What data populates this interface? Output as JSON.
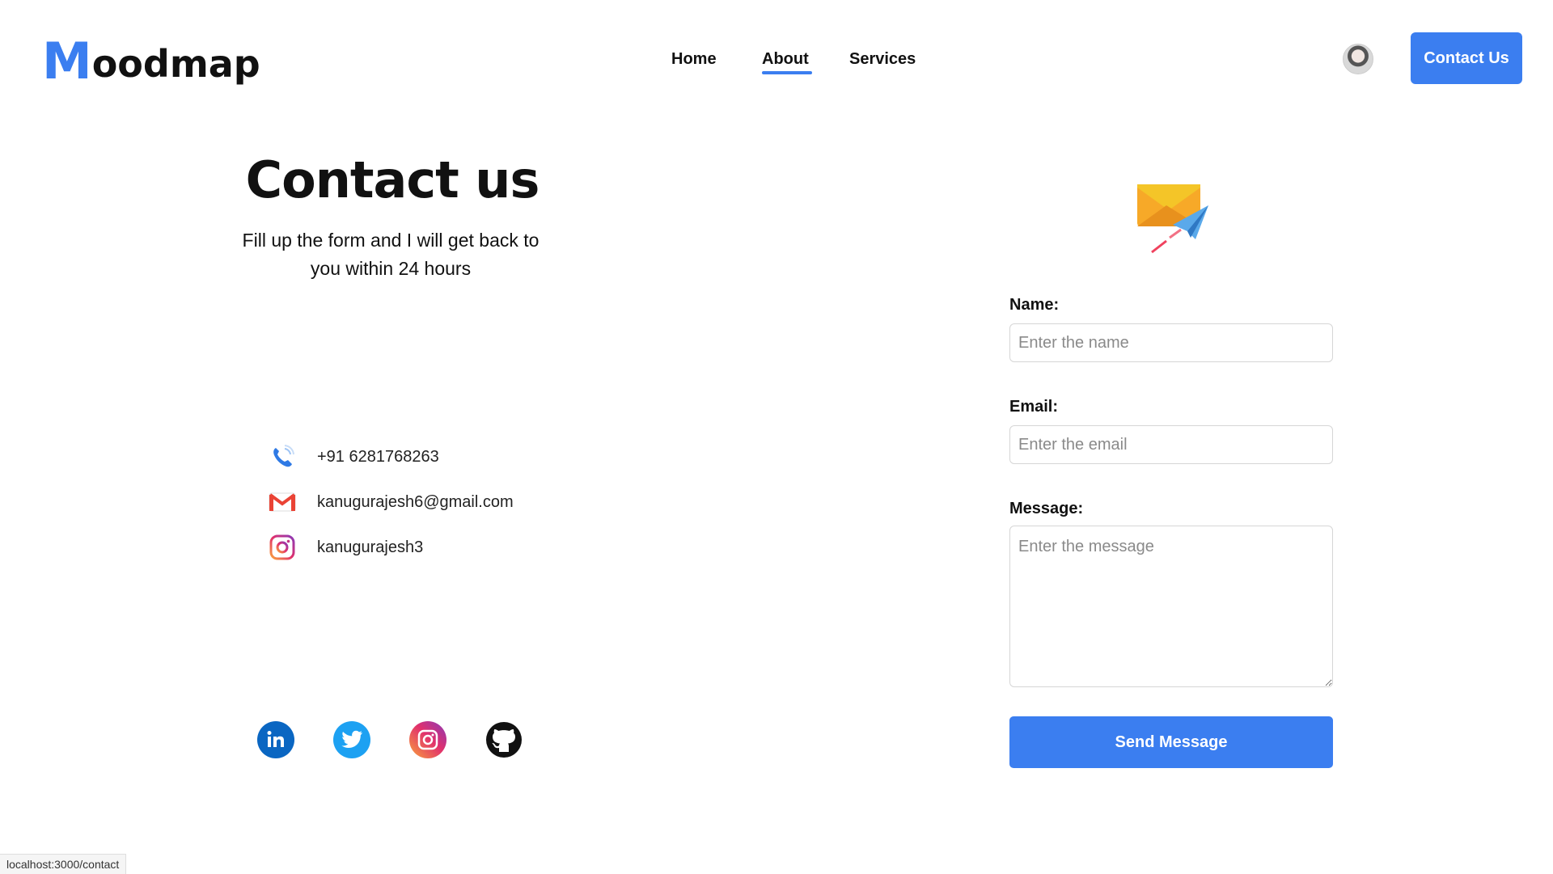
{
  "header": {
    "logo_first": "M",
    "logo_rest": "oodmap",
    "nav": [
      {
        "label": "Home"
      },
      {
        "label": "About"
      },
      {
        "label": "Services"
      }
    ],
    "active_nav": "About",
    "cta_label": "Contact Us"
  },
  "contact": {
    "title": "Contact us",
    "subtitle": "Fill up the form and I will get back to you within 24 hours",
    "phone": "+91 6281768263",
    "email": "kanugurajesh6@gmail.com",
    "instagram": "kanugurajesh3"
  },
  "social": [
    {
      "icon": "linkedin-icon"
    },
    {
      "icon": "twitter-icon"
    },
    {
      "icon": "instagram-icon"
    },
    {
      "icon": "github-icon"
    }
  ],
  "form": {
    "name_label": "Name:",
    "name_placeholder": "Enter the name",
    "email_label": "Email:",
    "email_placeholder": "Enter the email",
    "message_label": "Message:",
    "message_placeholder": "Enter the message",
    "submit_label": "Send Message"
  },
  "status_bar": {
    "url": "localhost:3000/contact"
  },
  "colors": {
    "accent": "#3b7ef0"
  }
}
